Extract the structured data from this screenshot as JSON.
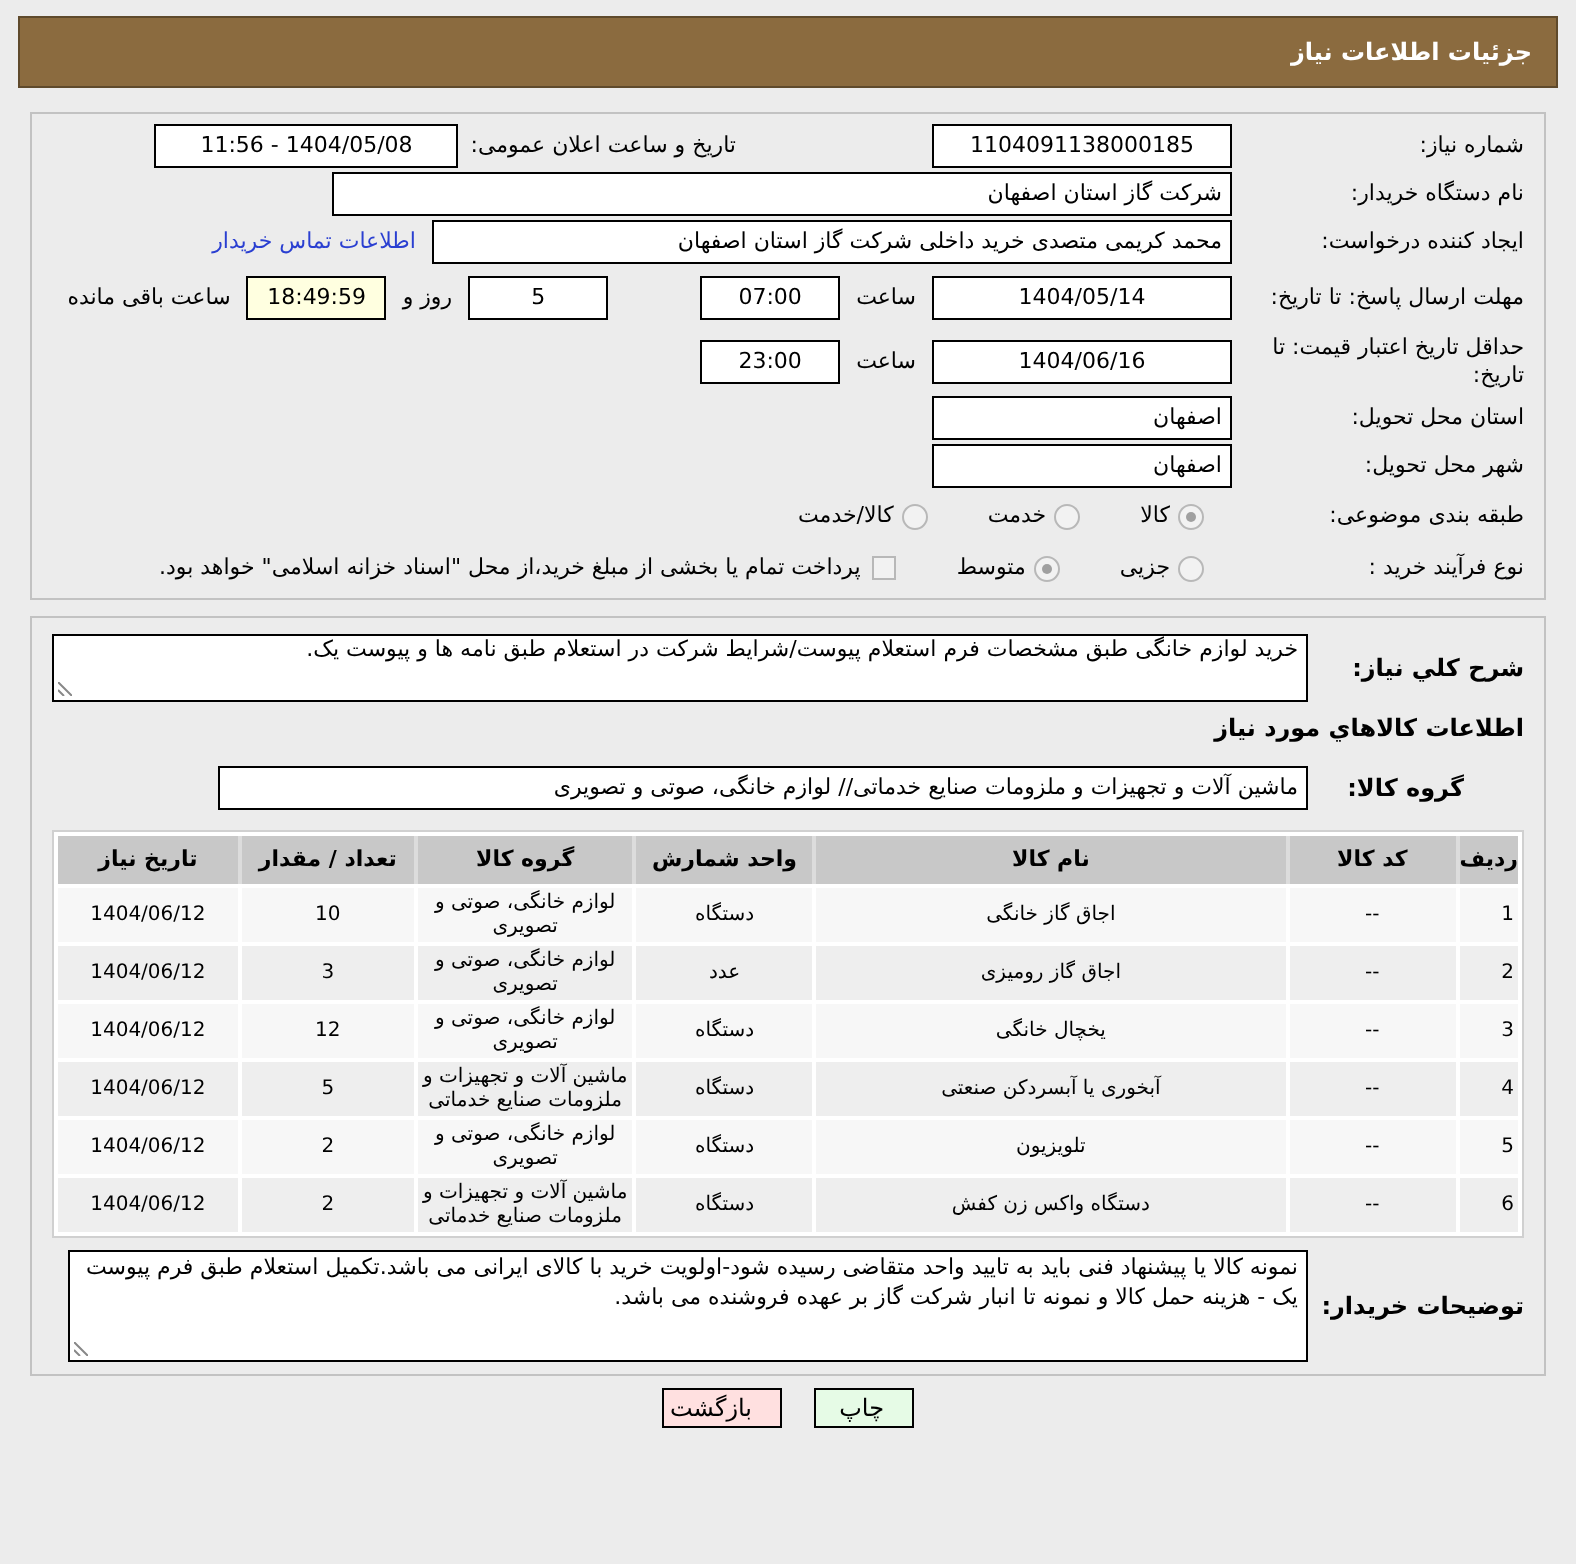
{
  "header": {
    "title": "جزئیات اطلاعات نیاز"
  },
  "form": {
    "need_number": {
      "label": "شماره نیاز:",
      "value": "1104091138000185"
    },
    "announce": {
      "label": "تاریخ و ساعت اعلان عمومی:",
      "value": "1404/05/08 - 11:56"
    },
    "buyer_org": {
      "label": "نام دستگاه خریدار:",
      "value": "شرکت گاز استان اصفهان"
    },
    "requester": {
      "label": "ایجاد کننده درخواست:",
      "value": "محمد کریمی متصدی خرید داخلی شرکت گاز استان اصفهان",
      "link": "اطلاعات تماس خریدار"
    },
    "deadline": {
      "label": "مهلت ارسال پاسخ: تا تاریخ:",
      "date": "1404/05/14",
      "time_label": "ساعت",
      "time": "07:00",
      "days": "5",
      "days_label": "روز و",
      "remaining": "18:49:59",
      "remaining_label": "ساعت باقی مانده"
    },
    "validity": {
      "label": "حداقل تاریخ اعتبار قیمت: تا تاریخ:",
      "date": "1404/06/16",
      "time_label": "ساعت",
      "time": "23:00"
    },
    "province": {
      "label": "استان محل تحویل:",
      "value": "اصفهان"
    },
    "city": {
      "label": "شهر محل تحویل:",
      "value": "اصفهان"
    },
    "category": {
      "label": "طبقه بندی موضوعی:",
      "options": [
        {
          "label": "کالا",
          "selected": true
        },
        {
          "label": "خدمت",
          "selected": false
        },
        {
          "label": "کالا/خدمت",
          "selected": false
        }
      ]
    },
    "process": {
      "label": "نوع فرآیند خرید :",
      "options": [
        {
          "label": "جزیی",
          "selected": false
        },
        {
          "label": "متوسط",
          "selected": true
        }
      ],
      "payment": {
        "checked": false,
        "text": "پرداخت تمام یا بخشی از مبلغ خرید،از محل \"اسناد خزانه اسلامی\" خواهد بود."
      }
    }
  },
  "description": {
    "label": "شرح کلي نياز:",
    "value": "خرید لوازم خانگی  طبق مشخصات  فرم استعلام  پیوست/شرایط شرکت در استعلام طبق نامه ها و پیوست یک."
  },
  "goods_title": "اطلاعات کالاهاي مورد نياز",
  "goods_group": {
    "label": "گروه کالا:",
    "value": "ماشین آلات و تجهیزات و ملزومات صنایع خدماتی// لوازم خانگی، صوتی و تصویری"
  },
  "table": {
    "columns": [
      "ردیف",
      "کد کالا",
      "نام کالا",
      "واحد شمارش",
      "گروه کالا",
      "تعداد / مقدار",
      "تاریخ نیاز"
    ],
    "rows": [
      [
        "1",
        "--",
        "اجاق گاز خانگی",
        "دستگاه",
        "لوازم خانگی، صوتی و تصویری",
        "10",
        "1404/06/12"
      ],
      [
        "2",
        "--",
        "اجاق گاز رومیزی",
        "عدد",
        "لوازم خانگی، صوتی و تصویری",
        "3",
        "1404/06/12"
      ],
      [
        "3",
        "--",
        "یخچال خانگی",
        "دستگاه",
        "لوازم خانگی، صوتی و تصویری",
        "12",
        "1404/06/12"
      ],
      [
        "4",
        "--",
        "آبخوری یا آبسردکن صنعتی",
        "دستگاه",
        "ماشین آلات و تجهیزات و ملزومات صنایع خدماتی",
        "5",
        "1404/06/12"
      ],
      [
        "5",
        "--",
        "تلویزیون",
        "دستگاه",
        "لوازم خانگی، صوتی و تصویری",
        "2",
        "1404/06/12"
      ],
      [
        "6",
        "--",
        "دستگاه واکس زن کفش",
        "دستگاه",
        "ماشین آلات و تجهیزات و ملزومات صنایع خدماتی",
        "2",
        "1404/06/12"
      ]
    ]
  },
  "notes": {
    "label": "توضیحات خریدار:",
    "value": "نمونه کالا یا پیشنهاد فنی باید به تایید واحد متقاضی رسیده شود-اولویت خرید با کالای ایرانی می باشد.تکمیل استعلام طبق فرم پیوست یک - هزینه حمل کالا و نمونه تا انبار شرکت گاز بر عهده فروشنده می باشد."
  },
  "buttons": [
    {
      "label": "چاپ",
      "kind": "print"
    },
    {
      "label": "بازگشت",
      "kind": "back"
    }
  ]
}
